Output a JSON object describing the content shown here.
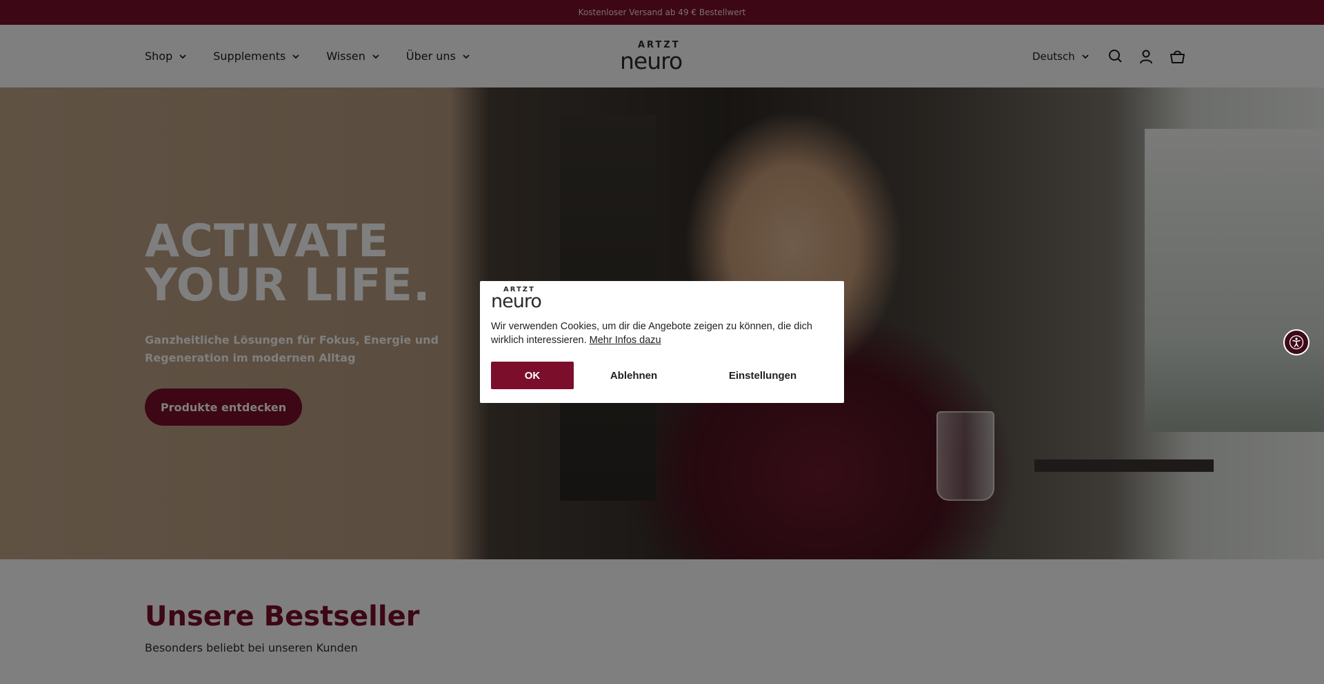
{
  "announcement": {
    "text": "Kostenloser Versand ab 49 € Bestellwert"
  },
  "header": {
    "nav": [
      {
        "label": "Shop"
      },
      {
        "label": "Supplements"
      },
      {
        "label": "Wissen"
      },
      {
        "label": "Über uns"
      }
    ],
    "logo": {
      "top": "ARTZT",
      "bottom": "neuro"
    },
    "language": "Deutsch",
    "icons": [
      "search-icon",
      "account-icon",
      "cart-icon"
    ]
  },
  "hero": {
    "title": "ACTIVATE YOUR LIFE.",
    "subtitle": "Ganzheitliche Lösungen für Fokus, Energie und Regeneration im modernen Alltag",
    "button": "Produkte entdecken"
  },
  "bestseller": {
    "title": "Unsere Bestseller",
    "subtitle": "Besonders beliebt bei unseren Kunden"
  },
  "cookie": {
    "logo_top": "ARTZT",
    "logo_bottom": "neuro",
    "text": "Wir verwenden Cookies, um dir die Angebote zeigen zu können, die dich wirklich interessieren.",
    "link": "Mehr Infos dazu",
    "ok": "OK",
    "decline": "Ablehnen",
    "settings": "Einstellungen"
  },
  "colors": {
    "brand": "#7a0e2b",
    "overlay": "rgba(0,0,0,0.5)"
  }
}
